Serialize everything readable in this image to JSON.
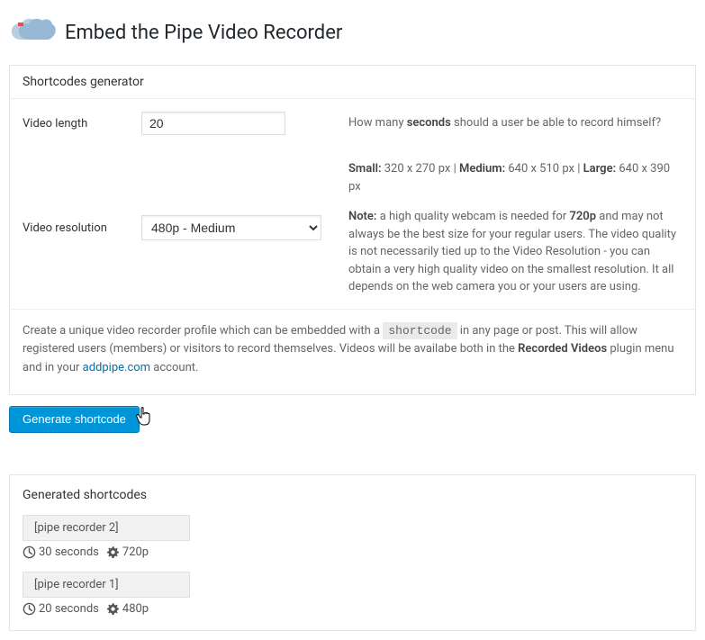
{
  "page_title": "Embed the Pipe Video Recorder",
  "shortcodes_generator": {
    "heading": "Shortcodes generator",
    "video_length": {
      "label": "Video length",
      "value": "20",
      "help_prefix": "How many ",
      "help_bold": "seconds",
      "help_suffix": " should a user be able to record himself?"
    },
    "video_resolution": {
      "label": "Video resolution",
      "value": "480p - Medium",
      "sizes": {
        "small_label": "Small:",
        "small_val": " 320 x 270 px | ",
        "medium_label": "Medium:",
        "medium_val": " 640 x 510 px | ",
        "large_label": "Large:",
        "large_val": " 640 x 390 px"
      },
      "note_label": "Note:",
      "note_prefix": " a high quality webcam is needed for ",
      "note_bold": "720p",
      "note_suffix": " and may not always be the best size for your regular users. The video quality is not necessarily tied up to the Video Resolution - you can obtain a very high quality video on the smallest resolution. It all depends on the web camera you or your users are using."
    },
    "footer": {
      "p1a": "Create a unique video recorder profile which can be embedded with a ",
      "code": "shortcode",
      "p1b": " in any page or post. This will allow registered users (members) or visitors to record themselves. Videos will be availabe both in the ",
      "p1c": "Recorded Videos",
      "p1d": " plugin menu and in your ",
      "link": "addpipe.com",
      "p1e": " account."
    }
  },
  "generate_button": "Generate shortcode",
  "generated": {
    "heading": "Generated shortcodes",
    "items": [
      {
        "label": "[pipe recorder 2]",
        "duration": "30 seconds",
        "res": "720p"
      },
      {
        "label": "[pipe recorder 1]",
        "duration": "20 seconds",
        "res": "480p"
      }
    ]
  }
}
